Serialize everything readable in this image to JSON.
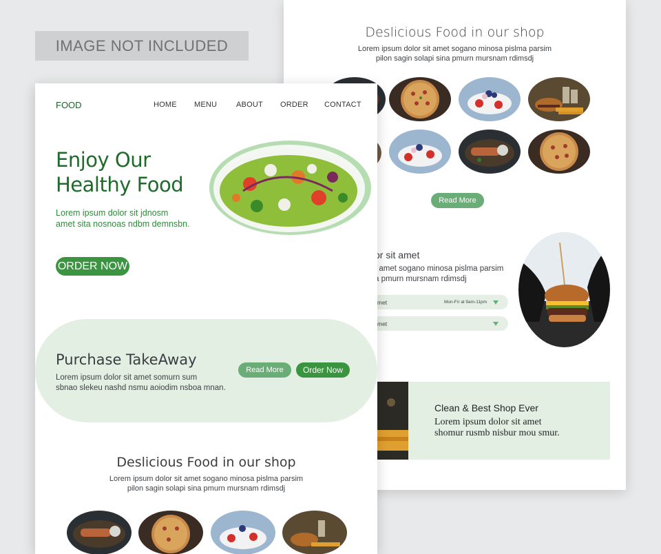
{
  "placeholder_badge": "IMAGE NOT INCLUDED",
  "back_page": {
    "section_title": "Deslicious Food in our shop",
    "section_desc_line1": "Lorem ipsum dolor sit amet sogano minosa pislma parsim",
    "section_desc_line2": "pilon sagin solapi sina pmurn mursnam rdimsdj",
    "read_more": "Read More",
    "mid_title": "or sit amet",
    "mid_desc_line1": "t amet sogano minosa pislma parsim",
    "mid_desc_line2": "a pmurn mursnam rdimsdj",
    "select1_label": "met",
    "select1_hours": "Mon-Fri at 9am-11pm",
    "select2_label": "met",
    "band_title": "Clean & Best Shop Ever",
    "band_desc_line1": "Lorem ipsum dolor sit amet",
    "band_desc_line2": "shomur rusmb nisbur mou smur."
  },
  "front_page": {
    "logo": "FOOD",
    "nav": [
      "HOME",
      "MENU",
      "ABOUT",
      "ORDER",
      "CONTACT"
    ],
    "hero_line1": "Enjoy Our",
    "hero_line2": "Healthy Food",
    "hero_sub_line1": "Lorem ipsum dolor sit jdnosm",
    "hero_sub_line2": "amet sita nosnoas ndbm demnsbn.",
    "order_now": "ORDER NOW",
    "purchase_title": "Purchase TakeAway",
    "purchase_desc_line1": "Lorem ipsum dolor sit amet somurn sum",
    "purchase_desc_line2": "sbnao slekeu nashd nsmu aoiodim nsboa mnan.",
    "purchase_read_more": "Read More",
    "purchase_order_now": "Order Now",
    "shop_title": "Deslicious Food in our shop",
    "shop_desc_line1": "Lorem ipsum dolor sit amet sogano minosa pislma parsim",
    "shop_desc_line2": "pilon sagin solapi sina pmurn mursnam rdimsdj"
  },
  "colors": {
    "accent_green": "#3a9440",
    "soft_green": "#6aad76",
    "pale_green": "#e4efe3",
    "heading_green": "#1f6b2c"
  }
}
